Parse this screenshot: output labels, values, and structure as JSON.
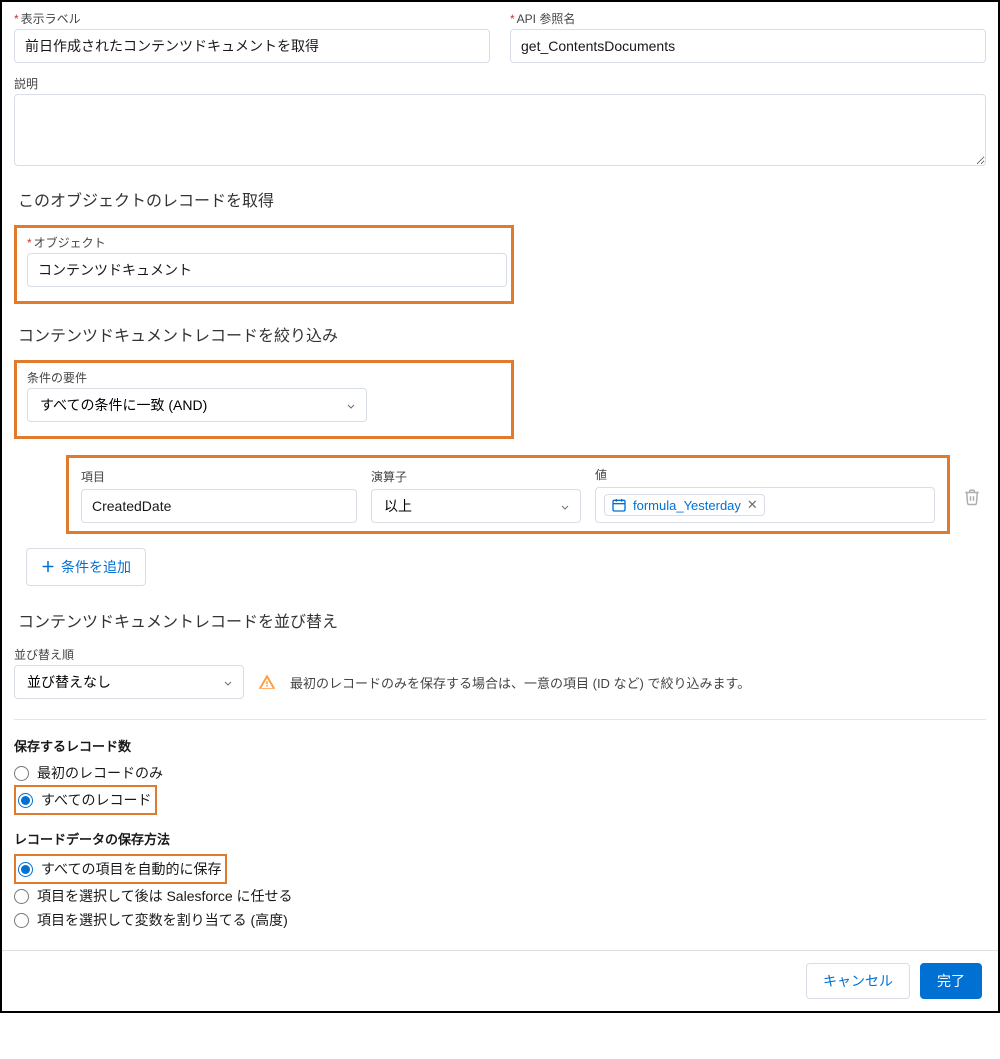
{
  "labels": {
    "displayLabel": "表示ラベル",
    "apiName": "API 参照名",
    "description": "説明",
    "section_object": "このオブジェクトのレコードを取得",
    "object": "オブジェクト",
    "section_filter": "コンテンツドキュメントレコードを絞り込み",
    "condition_req": "条件の要件",
    "field": "項目",
    "operator": "演算子",
    "value": "値",
    "add_condition": "条件を追加",
    "section_sort": "コンテンツドキュメントレコードを並び替え",
    "sort_order": "並び替え順",
    "sort_help": "最初のレコードのみを保存する場合は、一意の項目 (ID など) で絞り込みます。",
    "store_count": "保存するレコード数",
    "store_first": "最初のレコードのみ",
    "store_all": "すべてのレコード",
    "store_method": "レコードデータの保存方法",
    "method_auto": "すべての項目を自動的に保存",
    "method_choose_sf": "項目を選択して後は Salesforce に任せる",
    "method_choose_var": "項目を選択して変数を割り当てる (高度)",
    "cancel": "キャンセル",
    "done": "完了"
  },
  "values": {
    "displayLabel": "前日作成されたコンテンツドキュメントを取得",
    "apiName": "get_ContentsDocuments",
    "description": "",
    "object": "コンテンツドキュメント",
    "condition_logic": "すべての条件に一致 (AND)",
    "filter_field": "CreatedDate",
    "filter_operator": "以上",
    "filter_value": "formula_Yesterday",
    "sort_value": "並び替えなし"
  }
}
